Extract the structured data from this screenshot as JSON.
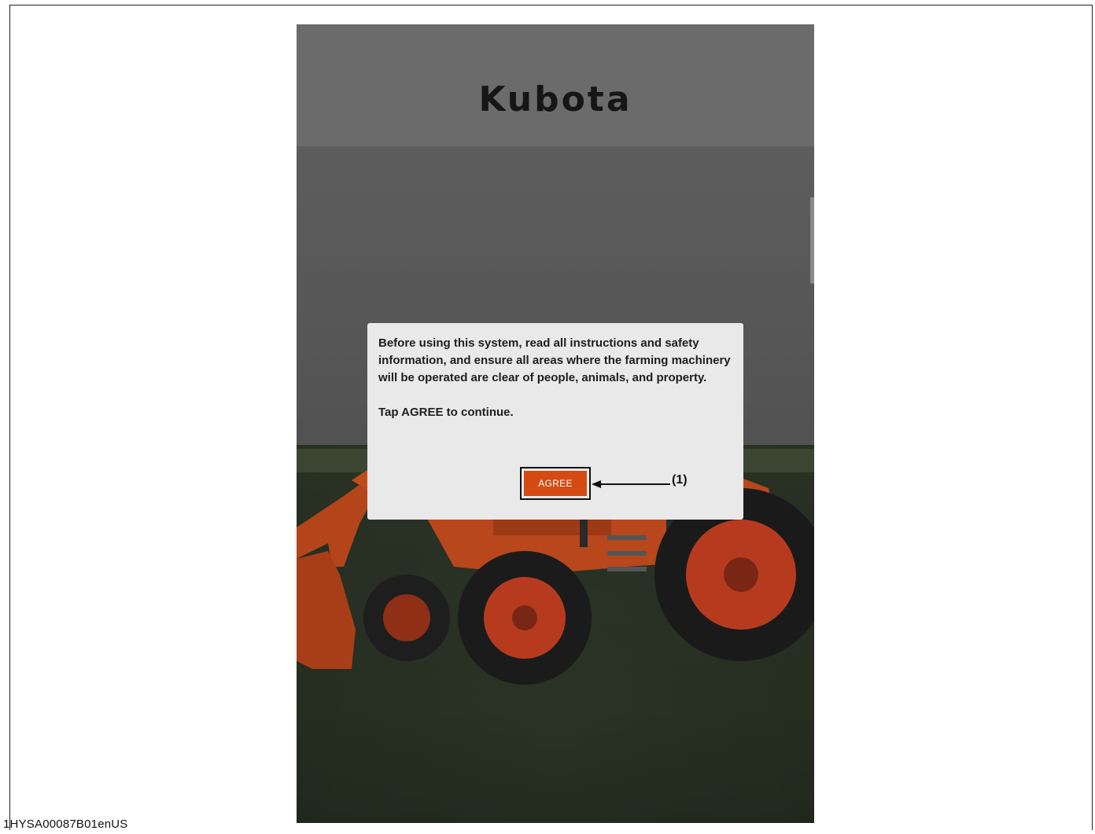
{
  "app": {
    "logo_text": "Kubota"
  },
  "dialog": {
    "message": "Before using this system, read all instructions and safety information, and ensure all areas where the farming machinery will be operated are clear of people, animals, and property.",
    "instruction": "Tap AGREE to continue.",
    "agree_label": "AGREE"
  },
  "annotation": {
    "callout_label": "(1)"
  },
  "document": {
    "id": "1HYSA00087B01enUS"
  },
  "colors": {
    "accent": "#d54a12",
    "dialog_bg": "#e9e9e9",
    "overlay": "#5e5e5e"
  },
  "icons": {
    "callout_arrow": "arrow-left-icon"
  }
}
